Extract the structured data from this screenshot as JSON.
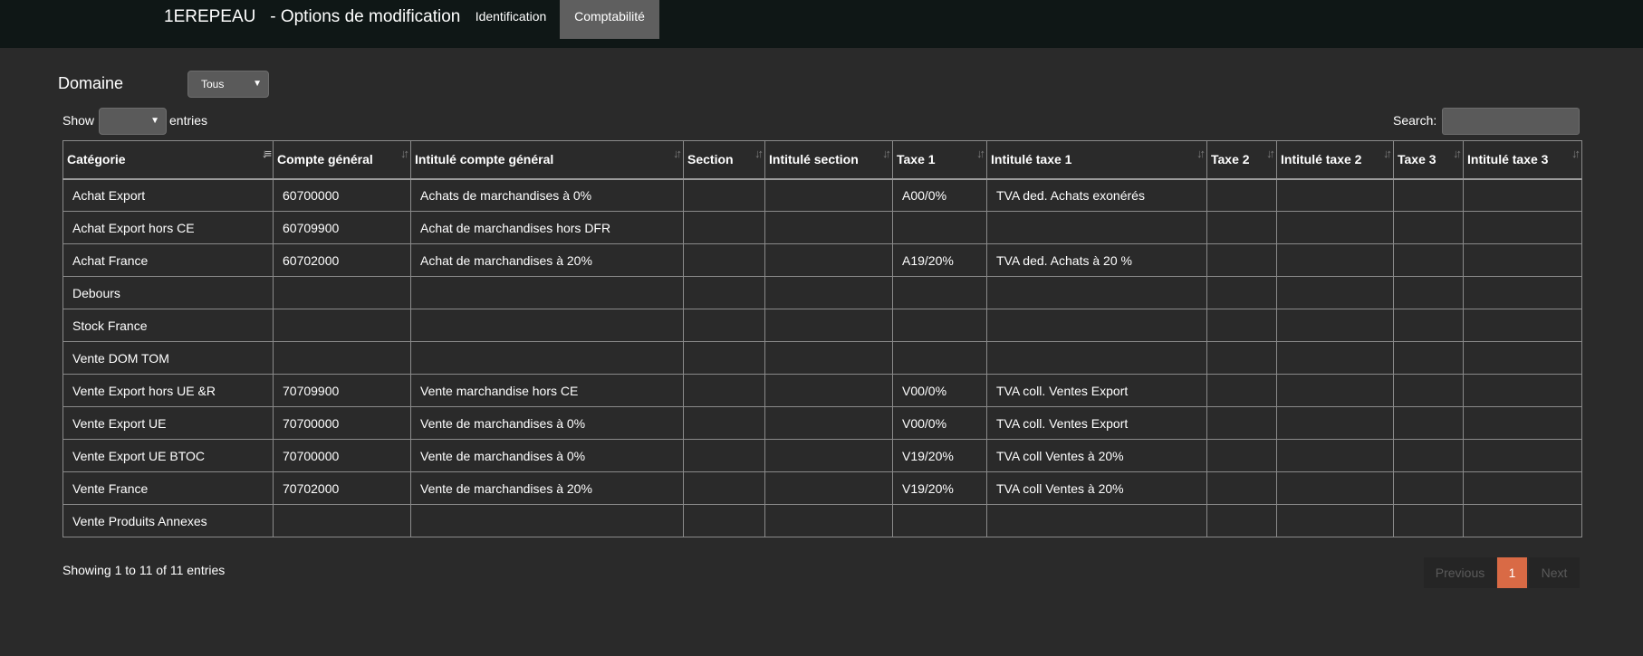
{
  "header": {
    "title": "1EREPEAU   - Options de modification",
    "tabs": [
      {
        "label": "Identification",
        "active": false
      },
      {
        "label": "Comptabilité",
        "active": true
      }
    ]
  },
  "filter": {
    "domaine_label": "Domaine",
    "domaine_value": "Tous"
  },
  "table_controls": {
    "show_label": "Show",
    "entries_label": "entries",
    "entries_value": "",
    "search_label": "Search:",
    "search_value": ""
  },
  "table": {
    "columns": [
      "Catégorie",
      "Compte général",
      "Intitulé compte général",
      "Section",
      "Intitulé section",
      "Taxe 1",
      "Intitulé taxe 1",
      "Taxe 2",
      "Intitulé taxe 2",
      "Taxe 3",
      "Intitulé taxe 3"
    ],
    "rows": [
      [
        "Achat Export",
        "60700000",
        "Achats de marchandises à 0%",
        "",
        "",
        "A00/0%",
        "TVA ded. Achats exonérés",
        "",
        "",
        "",
        ""
      ],
      [
        "Achat Export hors CE",
        "60709900",
        "Achat de marchandises hors DFR",
        "",
        "",
        "",
        "",
        "",
        "",
        "",
        ""
      ],
      [
        "Achat France",
        "60702000",
        "Achat de marchandises à 20%",
        "",
        "",
        "A19/20%",
        "TVA ded. Achats à 20 %",
        "",
        "",
        "",
        ""
      ],
      [
        "Debours",
        "",
        "",
        "",
        "",
        "",
        "",
        "",
        "",
        "",
        ""
      ],
      [
        "Stock France",
        "",
        "",
        "",
        "",
        "",
        "",
        "",
        "",
        "",
        ""
      ],
      [
        "Vente DOM TOM",
        "",
        "",
        "",
        "",
        "",
        "",
        "",
        "",
        "",
        ""
      ],
      [
        "Vente Export hors UE &R",
        "70709900",
        "Vente marchandise hors CE",
        "",
        "",
        "V00/0%",
        "TVA coll. Ventes Export",
        "",
        "",
        "",
        ""
      ],
      [
        "Vente Export UE",
        "70700000",
        "Vente de marchandises à 0%",
        "",
        "",
        "V00/0%",
        "TVA coll. Ventes Export",
        "",
        "",
        "",
        ""
      ],
      [
        "Vente Export UE BTOC",
        "70700000",
        "Vente de marchandises à 0%",
        "",
        "",
        "V19/20%",
        "TVA coll Ventes à 20%",
        "",
        "",
        "",
        ""
      ],
      [
        "Vente France",
        "70702000",
        "Vente de marchandises à 20%",
        "",
        "",
        "V19/20%",
        "TVA coll Ventes à 20%",
        "",
        "",
        "",
        ""
      ],
      [
        "Vente Produits Annexes",
        "",
        "",
        "",
        "",
        "",
        "",
        "",
        "",
        "",
        ""
      ]
    ]
  },
  "footer": {
    "info": "Showing 1 to 11 of 11 entries",
    "previous_label": "Previous",
    "current_page": "1",
    "next_label": "Next"
  },
  "colors": {
    "background": "#2a2a2a",
    "topbar": "#0f1716",
    "active_tab": "#5f5f5f",
    "active_page": "#d96a45"
  }
}
